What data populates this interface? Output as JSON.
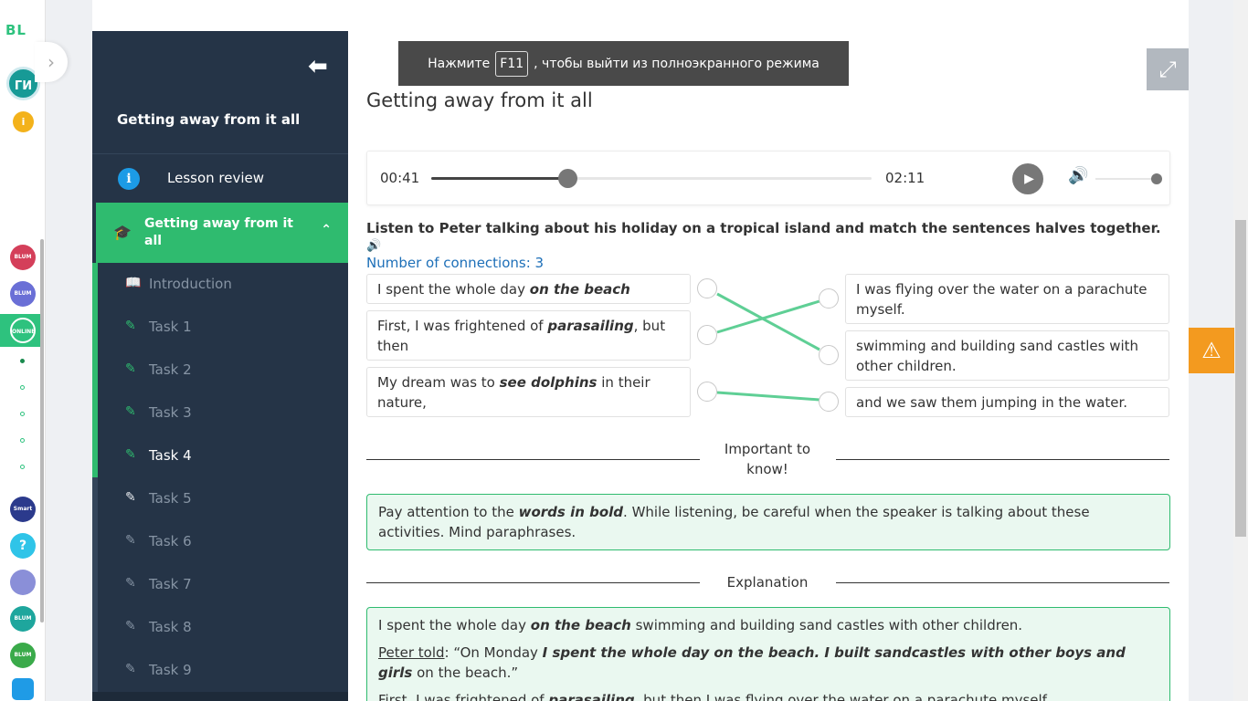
{
  "rail": {
    "logo": "BL",
    "avatar": "ГИ",
    "info": "i",
    "apps": [
      "BLUM SHOP",
      "BLUM BIZNES",
      "ONLINE ШКОЛА",
      "Smart Nation",
      "?",
      "",
      "BLUM ONLINE",
      "BLUM Land",
      ""
    ]
  },
  "sidebar": {
    "back_icon": "arrow-left-icon",
    "course_title": "Getting away from it all",
    "lesson_review": "Lesson review",
    "module_title": "Getting away from it all",
    "items": [
      {
        "label": "Introduction",
        "icon": "book-icon"
      },
      {
        "label": "Task 1",
        "icon": "edit-icon"
      },
      {
        "label": "Task 2",
        "icon": "edit-icon"
      },
      {
        "label": "Task 3",
        "icon": "edit-icon"
      },
      {
        "label": "Task 4",
        "icon": "edit-icon"
      },
      {
        "label": "Task 5",
        "icon": "edit-icon"
      },
      {
        "label": "Task 6",
        "icon": "edit-icon"
      },
      {
        "label": "Task 7",
        "icon": "edit-icon"
      },
      {
        "label": "Task 8",
        "icon": "edit-icon"
      },
      {
        "label": "Task 9",
        "icon": "edit-icon"
      }
    ]
  },
  "fullscreen": {
    "text_before": "Нажмите",
    "key": "F11",
    "text_after": ", чтобы выйти из полноэкранного режима"
  },
  "main": {
    "title": "Getting away from it all",
    "player": {
      "current": "00:41",
      "duration": "02:11",
      "progress": 0.31,
      "volume": 1.0
    },
    "instruction": "Listen to Peter talking about his holiday on a tropical island and match the sentences halves together.",
    "connections_label": "Number of connections: 3",
    "left": [
      {
        "pre": "I spent the whole day ",
        "bold": "on the beach",
        "post": ""
      },
      {
        "pre": "First, I was frightened of ",
        "bold": "parasailing",
        "post": ", but then"
      },
      {
        "pre": "My dream was to ",
        "bold": "see dolphins",
        "post": " in their nature,"
      }
    ],
    "right": [
      "I was flying over the water on a parachute myself.",
      "swimming and building sand castles with other children.",
      "and we saw them jumping in the water."
    ],
    "important_label": "Important to know!",
    "tip": {
      "pre": "Pay attention to the ",
      "bold": "words in bold",
      "post": ". While listening, be careful when the speaker is talking about these activities. Mind paraphrases."
    },
    "explanation_label": "Explanation",
    "explanation": {
      "line1_pre": "I spent the whole day ",
      "line1_bold": "on the beach",
      "line1_post": " swimming and building sand castles with other children.",
      "speaker": "Peter told",
      "quote_pre": ": “On Monday ",
      "quote_bold": "I spent the whole day on the beach. I built sandcastles with other boys and girls",
      "quote_post": " on the beach.”",
      "line3_pre": "First, I was frightened of ",
      "line3_bold": "parasailing",
      "line3_post": ", but then I was flying over the water on a parachute myself."
    }
  },
  "colors": {
    "accent": "#2fbb6f",
    "sidebar": "#253447",
    "link": "#1d6fb8",
    "warning": "#f39a1f"
  }
}
